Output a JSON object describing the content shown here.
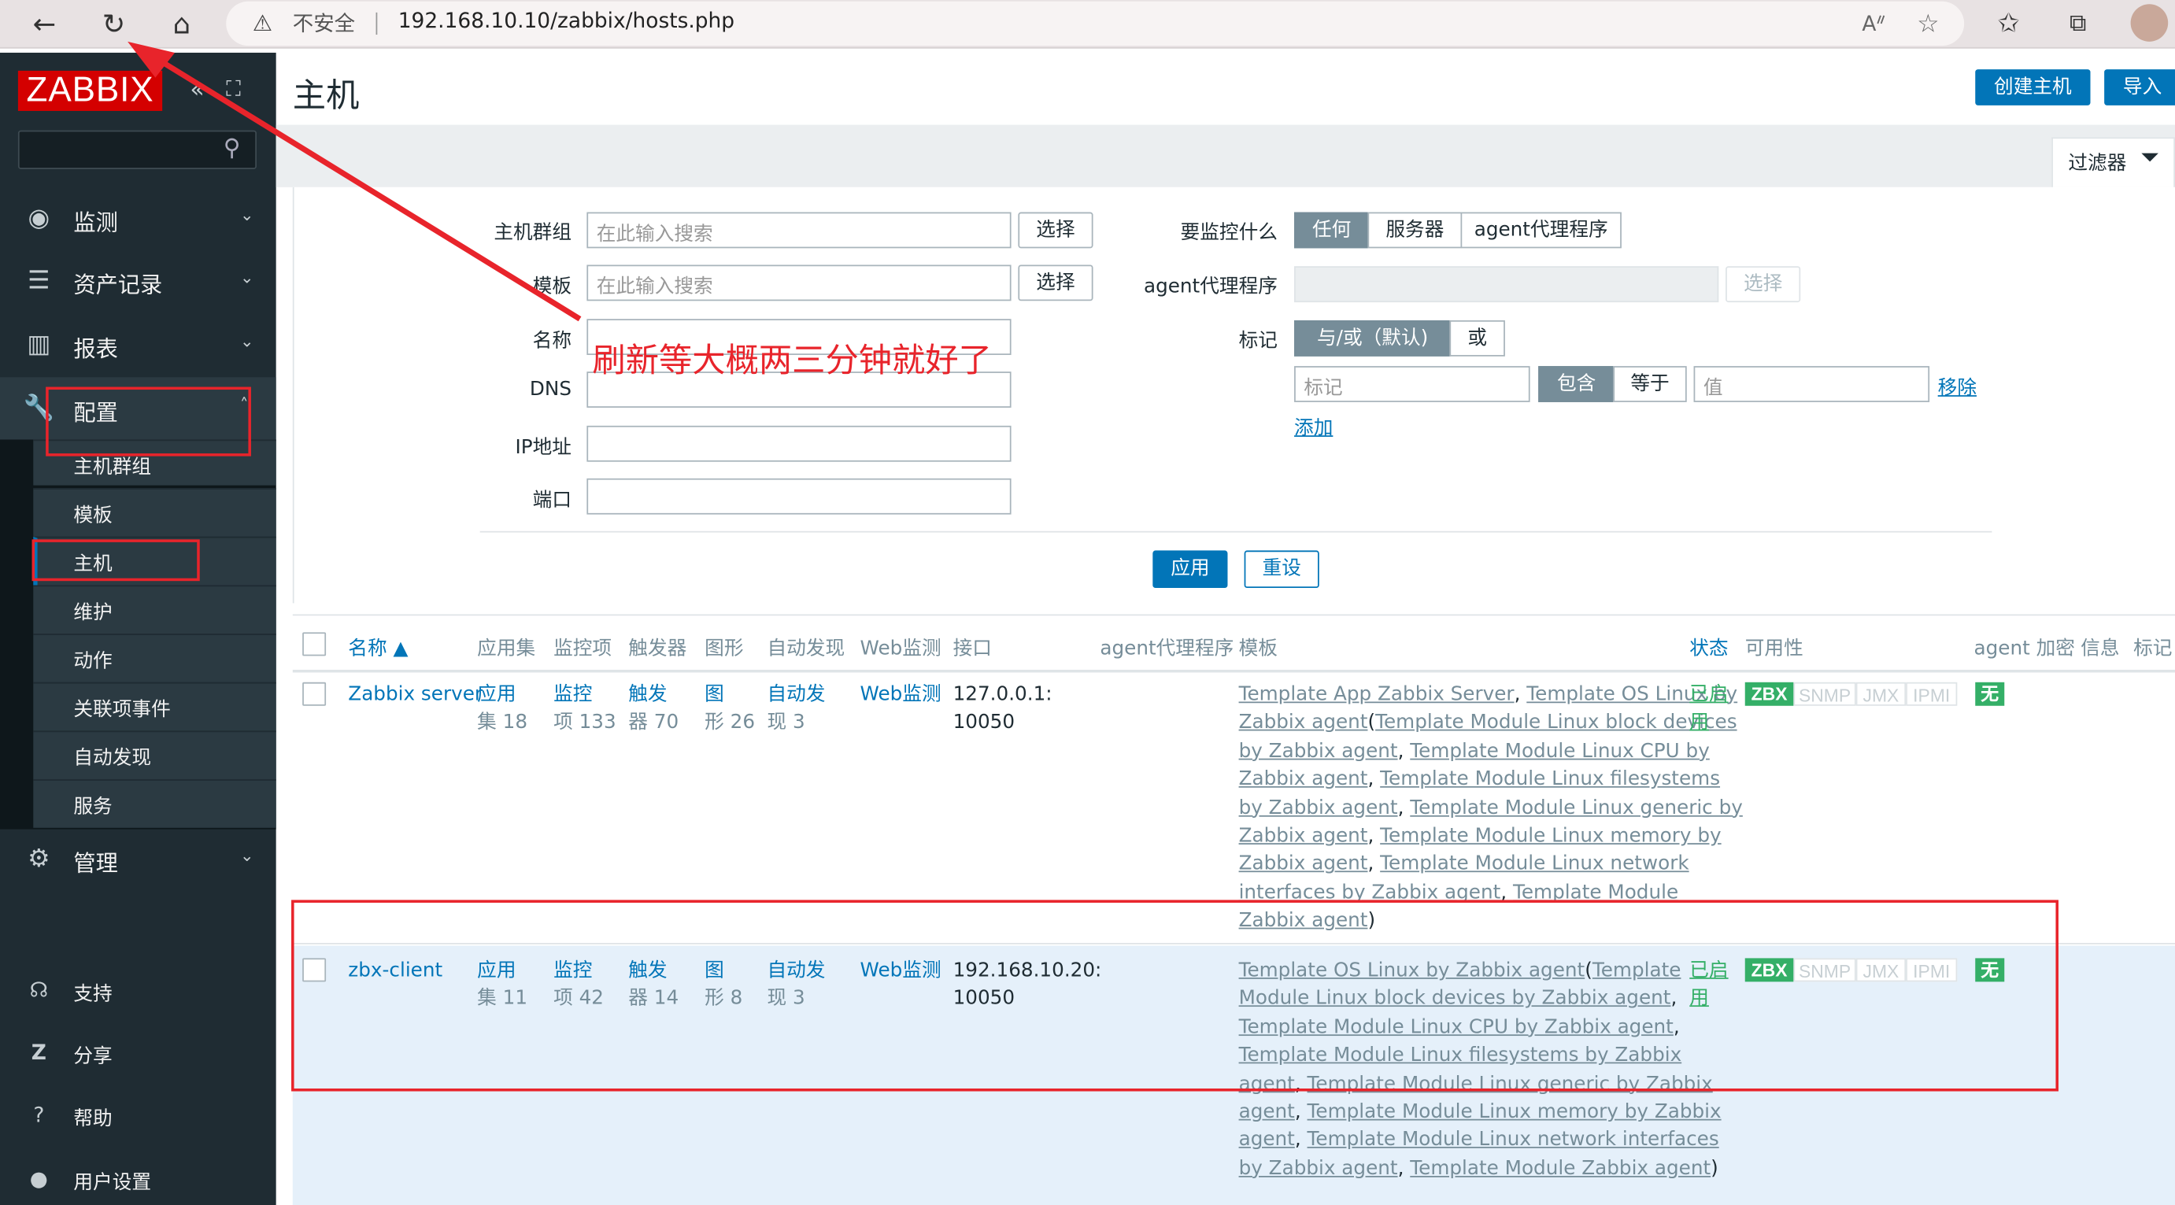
{
  "browser": {
    "warning": "不安全",
    "url": "192.168.10.10/zabbix/hosts.php"
  },
  "sidebar": {
    "logo": "ZABBIX",
    "menu": [
      {
        "label": "监测",
        "icon": "eye-icon"
      },
      {
        "label": "资产记录",
        "icon": "list-icon"
      },
      {
        "label": "报表",
        "icon": "bar-chart-icon"
      },
      {
        "label": "配置",
        "icon": "wrench-icon"
      },
      {
        "label": "管理",
        "icon": "gear-icon"
      }
    ],
    "config_sub": [
      "主机群组",
      "模板",
      "主机",
      "维护",
      "动作",
      "关联项事件",
      "自动发现",
      "服务"
    ],
    "bottom": [
      {
        "label": "支持",
        "icon": "headset-icon"
      },
      {
        "label": "分享",
        "icon": "share-icon"
      },
      {
        "label": "帮助",
        "icon": "help-icon"
      },
      {
        "label": "用户设置",
        "icon": "user-icon"
      }
    ]
  },
  "header": {
    "title": "主机",
    "create_host": "创建主机",
    "import": "导入",
    "filter_tab": "过滤器"
  },
  "filter": {
    "labels": {
      "host_group": "主机群组",
      "template": "模板",
      "name": "名称",
      "dns": "DNS",
      "ip": "IP地址",
      "port": "端口",
      "monitored_by": "要监控什么",
      "proxy": "agent代理程序",
      "tags": "标记"
    },
    "placeholder": "在此输入搜索",
    "select": "选择",
    "monitored_options": [
      "任何",
      "服务器",
      "agent代理程序"
    ],
    "tag_logic": [
      "与/或（默认)",
      "或"
    ],
    "tag_placeholder": "标记",
    "tag_ops": [
      "包含",
      "等于"
    ],
    "value_placeholder": "值",
    "remove": "移除",
    "add": "添加",
    "apply": "应用",
    "reset": "重设"
  },
  "table": {
    "headers": [
      "名称 ▲",
      "应用集",
      "监控项",
      "触发器",
      "图形",
      "自动发现",
      "Web监测",
      "接口",
      "agent代理程序",
      "模板",
      "状态",
      "可用性",
      "agent 加密",
      "信息",
      "标记"
    ],
    "rows": [
      {
        "name": "Zabbix server",
        "apps": [
          "应用",
          "集 18"
        ],
        "items": [
          "监控",
          "项 133"
        ],
        "triggers": [
          "触发",
          "器 70"
        ],
        "graphs": [
          "图",
          "形 26"
        ],
        "discovery": [
          "自动发",
          "现 3"
        ],
        "web": "Web监测",
        "interface": [
          "127.0.0.1:",
          "10050"
        ],
        "templates": [
          "Template App Zabbix Server, Template OS Linux by",
          "Zabbix agent (Template Module Linux block devices",
          "by Zabbix agent, Template Module Linux CPU by",
          "Zabbix agent, Template Module Linux filesystems",
          "by Zabbix agent, Template Module Linux generic by",
          "Zabbix agent, Template Module Linux memory by",
          "Zabbix agent, Template Module Linux network",
          "interfaces by Zabbix agent, Template Module",
          "Zabbix agent)"
        ],
        "status": [
          "已启",
          "用"
        ],
        "avail": [
          "ZBX",
          "SNMP",
          "JMX",
          "IPMI"
        ],
        "encryption": "无"
      },
      {
        "name": "zbx-client",
        "apps": [
          "应用",
          "集 11"
        ],
        "items": [
          "监控",
          "项 42"
        ],
        "triggers": [
          "触发",
          "器 14"
        ],
        "graphs": [
          "图",
          "形 8"
        ],
        "discovery": [
          "自动发",
          "现 3"
        ],
        "web": "Web监测",
        "interface": [
          "192.168.10.20:",
          "10050"
        ],
        "templates": [
          "Template OS Linux by Zabbix agent (Template",
          "Module Linux block devices by Zabbix agent,",
          "Template Module Linux CPU by Zabbix agent,",
          "Template Module Linux filesystems by Zabbix",
          "agent, Template Module Linux generic by Zabbix",
          "agent, Template Module Linux memory by Zabbix",
          "agent, Template Module Linux network interfaces",
          "by Zabbix agent, Template Module Zabbix agent)"
        ],
        "status": [
          "已启",
          "用"
        ],
        "avail": [
          "ZBX",
          "SNMP",
          "JMX",
          "IPMI"
        ],
        "encryption": "无"
      }
    ]
  },
  "annotation": {
    "note": "刷新等大概两三分钟就好了",
    "color": "#e8242b"
  },
  "colors": {
    "brand": "#d40000",
    "accent": "#0275b8",
    "sidebar": "#1f2c33",
    "ok": "#34af67"
  }
}
